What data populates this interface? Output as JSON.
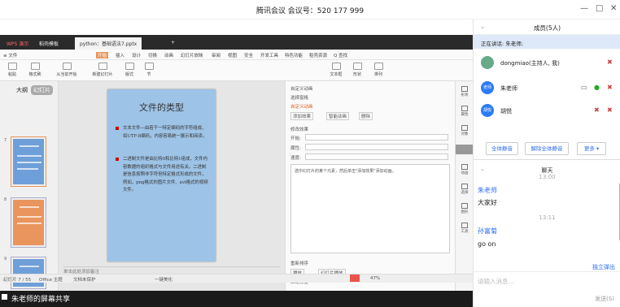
{
  "window": {
    "title": "腾讯会议 会议号：520 177 999",
    "min": "—",
    "max": "□",
    "close": "✕"
  },
  "wps": {
    "tabs": [
      "WPS 演示",
      "稻壳模板",
      "python：基础语法7.pptx",
      "+"
    ],
    "menu": [
      "≡ 文件",
      "开始",
      "插入",
      "设计",
      "切换",
      "动画",
      "幻灯片放映",
      "审阅",
      "视图",
      "安全",
      "开发工具",
      "特色功能",
      "稻壳资源",
      "Q 查找"
    ],
    "toolbar": [
      "粘贴",
      "格式刷",
      "从当前开始",
      "新建幻灯片",
      "版式",
      "节",
      "文本框",
      "形状",
      "排列"
    ],
    "thumb_tabs": [
      "大纲",
      "幻灯片"
    ],
    "slide": {
      "title": "文件的类型",
      "bullets": [
        "文本文件—由若干一特定编码的字符组成，如UTF-8编码，内容容易统一展示和阅读。",
        "二进制文件是由比特0和比特1组成，文件内容数据的组织格式与文件用途有关。二进制是信息按照非字符但特定格式形成的文件，例如，png格式的图片文件、avi格式的视频文件。"
      ]
    },
    "anim": {
      "title": "自定义动画",
      "select": "选择窗格",
      "custom": "自定义动画",
      "add": "添加效果",
      "smart": "智能动画",
      "del": "删除",
      "modify": "修改效果",
      "start_l": "开始:",
      "prop_l": "属性:",
      "speed_l": "速度:",
      "hint": "选中幻灯片的某个元素，然后单击\"添加效果\"添加动画。",
      "reorder": "重新排序",
      "play": "播放",
      "show": "幻灯片播放",
      "auto": "自动预览"
    },
    "rtools": [
      "形状",
      "属性",
      "对象",
      "动画",
      "选择",
      "图形",
      "工具"
    ],
    "status": {
      "page": "幻灯片 7 / 55",
      "theme": "Office 主题",
      "doc": "文档未保护",
      "mode": "一键美化",
      "zoom": "47%"
    },
    "notes": "单击此处添加备注"
  },
  "share_banner": "朱老师的屏幕共享",
  "panel": {
    "header": "成员(5人)",
    "speaking": "正在讲话: 朱老师;",
    "members": [
      {
        "name": "dongmiao(主持人, 我)",
        "av": ""
      },
      {
        "name": "朱老师",
        "av": "老师"
      },
      {
        "name": "胡悦",
        "av": "胡悦"
      }
    ],
    "actions": [
      "全体静音",
      "解除全体静音",
      "更多 ▾"
    ],
    "chat_title": "聊天",
    "messages": [
      {
        "ts": "13:00",
        "user": "朱老师",
        "text": "大家好"
      },
      {
        "ts": "13:11",
        "user": "孙富菊",
        "text": "go on"
      }
    ],
    "popout": "独立弹出",
    "input_ph": "请输入消息...",
    "send": "发送(S)"
  }
}
